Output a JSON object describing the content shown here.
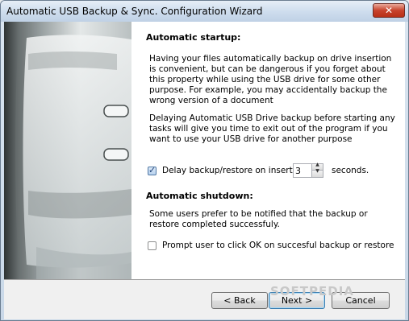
{
  "window": {
    "title": "Automatic USB Backup & Sync. Configuration Wizard",
    "close_label": "✕"
  },
  "startup": {
    "heading": "Automatic startup:",
    "paragraph1": "Having your files automatically backup on drive insertion is convenient, but can be dangerous if you forget about this property while using the USB drive for some other purpose. For example, you may accidentally backup the wrong version of a document",
    "paragraph2": "Delaying Automatic USB Drive backup before starting any tasks will give you time to exit out of the program if you want to use your USB drive for another purpose",
    "delay_label": "Delay backup/restore on insert",
    "delay_checked": true,
    "delay_value": "3",
    "delay_units": "seconds."
  },
  "shutdown": {
    "heading": "Automatic shutdown:",
    "paragraph": "Some users prefer to be notified that the backup or restore completed successfuly.",
    "prompt_label": "Prompt user to click OK on succesful backup or restore",
    "prompt_checked": false
  },
  "buttons": {
    "back": "< Back",
    "next": "Next >",
    "cancel": "Cancel"
  },
  "watermark": "SOFTPEDIA"
}
